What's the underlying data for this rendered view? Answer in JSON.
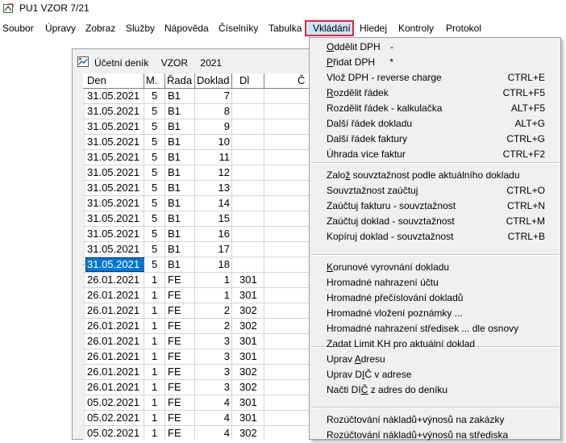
{
  "window": {
    "title": "PU1 VZOR 7/21"
  },
  "menu": [
    {
      "label": "Soubor"
    },
    {
      "label": "Úpravy"
    },
    {
      "label": "Zobraz"
    },
    {
      "label": "Služby"
    },
    {
      "label": "Nápověda"
    },
    {
      "label": "Číselníky"
    },
    {
      "label": "Tabulka"
    },
    {
      "label": "Vkládání"
    },
    {
      "label": "Hledej"
    },
    {
      "label": "Kontroly"
    },
    {
      "label": "Protokol"
    }
  ],
  "subwindow": {
    "title": "Účetní deník",
    "company": "VZOR",
    "year": "2021"
  },
  "grid": {
    "headers": {
      "den": "Den",
      "m": "M.",
      "rada": "Řada",
      "doklad": "Doklad",
      "dl": "Dl",
      "rest": "Č"
    },
    "rows": [
      {
        "den": "31.05.2021",
        "m": "5",
        "rada": "B1",
        "doklad": "7",
        "dl": ""
      },
      {
        "den": "31.05.2021",
        "m": "5",
        "rada": "B1",
        "doklad": "8",
        "dl": ""
      },
      {
        "den": "31.05.2021",
        "m": "5",
        "rada": "B1",
        "doklad": "9",
        "dl": ""
      },
      {
        "den": "31.05.2021",
        "m": "5",
        "rada": "B1",
        "doklad": "10",
        "dl": ""
      },
      {
        "den": "31.05.2021",
        "m": "5",
        "rada": "B1",
        "doklad": "11",
        "dl": ""
      },
      {
        "den": "31.05.2021",
        "m": "5",
        "rada": "B1",
        "doklad": "12",
        "dl": ""
      },
      {
        "den": "31.05.2021",
        "m": "5",
        "rada": "B1",
        "doklad": "13",
        "dl": ""
      },
      {
        "den": "31.05.2021",
        "m": "5",
        "rada": "B1",
        "doklad": "14",
        "dl": ""
      },
      {
        "den": "31.05.2021",
        "m": "5",
        "rada": "B1",
        "doklad": "15",
        "dl": ""
      },
      {
        "den": "31.05.2021",
        "m": "5",
        "rada": "B1",
        "doklad": "16",
        "dl": ""
      },
      {
        "den": "31.05.2021",
        "m": "5",
        "rada": "B1",
        "doklad": "17",
        "dl": ""
      },
      {
        "den": "31.05.2021",
        "m": "5",
        "rada": "B1",
        "doklad": "18",
        "dl": "",
        "selected": true
      },
      {
        "den": "26.01.2021",
        "m": "1",
        "rada": "FE",
        "doklad": "1",
        "dl": "301"
      },
      {
        "den": "26.01.2021",
        "m": "1",
        "rada": "FE",
        "doklad": "1",
        "dl": "301"
      },
      {
        "den": "26.01.2021",
        "m": "1",
        "rada": "FE",
        "doklad": "2",
        "dl": "302"
      },
      {
        "den": "26.01.2021",
        "m": "1",
        "rada": "FE",
        "doklad": "2",
        "dl": "302"
      },
      {
        "den": "26.01.2021",
        "m": "1",
        "rada": "FE",
        "doklad": "3",
        "dl": "301"
      },
      {
        "den": "26.01.2021",
        "m": "1",
        "rada": "FE",
        "doklad": "3",
        "dl": "301"
      },
      {
        "den": "26.01.2021",
        "m": "1",
        "rada": "FE",
        "doklad": "3",
        "dl": "302"
      },
      {
        "den": "26.01.2021",
        "m": "1",
        "rada": "FE",
        "doklad": "3",
        "dl": "302"
      },
      {
        "den": "05.02.2021",
        "m": "1",
        "rada": "FE",
        "doklad": "4",
        "dl": "301"
      },
      {
        "den": "05.02.2021",
        "m": "1",
        "rada": "FE",
        "doklad": "4",
        "dl": "301"
      },
      {
        "den": "05.02.2021",
        "m": "1",
        "rada": "FE",
        "doklad": "4",
        "dl": "302"
      }
    ]
  },
  "dropdown": {
    "items": [
      {
        "label": "Oddělit DPH",
        "shortcut": "-"
      },
      {
        "label": "Přidat DPH",
        "shortcut": "*"
      },
      {
        "label": "Vlož DPH - reverse charge",
        "shortcut": "CTRL+E"
      },
      {
        "label": "Rozdělit řádek",
        "shortcut": "CTRL+F5"
      },
      {
        "label": "Rozdělit řádek - kalkulačka",
        "shortcut": "ALT+F5"
      },
      {
        "label": "Další řádek dokladu",
        "shortcut": "ALT+G"
      },
      {
        "label": "Další řádek faktury",
        "shortcut": "CTRL+G"
      },
      {
        "label": "Úhrada více faktur",
        "shortcut": "CTRL+F2"
      },
      {
        "label": "Založ souvztažnost podle aktuálního dokladu",
        "shortcut": ""
      },
      {
        "label": "Souvztažnost zaúčtuj",
        "shortcut": "CTRL+O"
      },
      {
        "label": "Zaúčtuj fakturu - souvztažnost",
        "shortcut": "CTRL+N"
      },
      {
        "label": "Zaúčtuj doklad - souvztažnost",
        "shortcut": "CTRL+M"
      },
      {
        "label": "Kopíruj doklad - souvztažnost",
        "shortcut": "CTRL+B"
      },
      {
        "label": "Korunové vyrovnání dokladu",
        "shortcut": ""
      },
      {
        "label": "Hromadné nahrazení účtu",
        "shortcut": ""
      },
      {
        "label": "Hromadné přečíslování dokladů",
        "shortcut": ""
      },
      {
        "label": "Hromadné vložení poznámky ...",
        "shortcut": ""
      },
      {
        "label": "Hromadné nahrazení středisek ... dle osnovy",
        "shortcut": ""
      },
      {
        "label": "Zadat Limit KH pro aktuální doklad",
        "shortcut": ""
      },
      {
        "label": "Uprav Adresu",
        "shortcut": ""
      },
      {
        "label": "Uprav DIČ v adrese",
        "shortcut": ""
      },
      {
        "label": "Načti DIČ z adres do deníku",
        "shortcut": ""
      },
      {
        "label": "Rozúčtování nákladů+výnosů na zakázky",
        "shortcut": ""
      },
      {
        "label": "Rozúčtování nákladů+výnosů na střediska",
        "shortcut": ""
      }
    ]
  }
}
